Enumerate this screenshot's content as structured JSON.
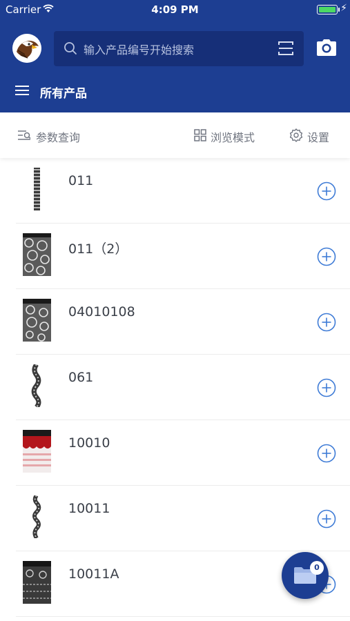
{
  "status_bar": {
    "carrier": "Carrier",
    "time": "4:09 PM"
  },
  "search": {
    "placeholder": "输入产品编号开始搜索"
  },
  "menu": {
    "title": "所有产品"
  },
  "toolbar": {
    "query_label": "参数查询",
    "browse_label": "浏览模式",
    "settings_label": "设置"
  },
  "products": [
    {
      "name": "011",
      "thumb": "narrow-bw"
    },
    {
      "name": "011（2）",
      "thumb": "lace-floral"
    },
    {
      "name": "04010108",
      "thumb": "lace-floral"
    },
    {
      "name": "061",
      "thumb": "narrow-trim"
    },
    {
      "name": "10010",
      "thumb": "red-white"
    },
    {
      "name": "10011",
      "thumb": "narrow-trim"
    },
    {
      "name": "10011A",
      "thumb": "lace-dark"
    }
  ],
  "cart": {
    "count": "0"
  },
  "colors": {
    "brand": "#1d3e92",
    "accent": "#3e7bd6"
  }
}
